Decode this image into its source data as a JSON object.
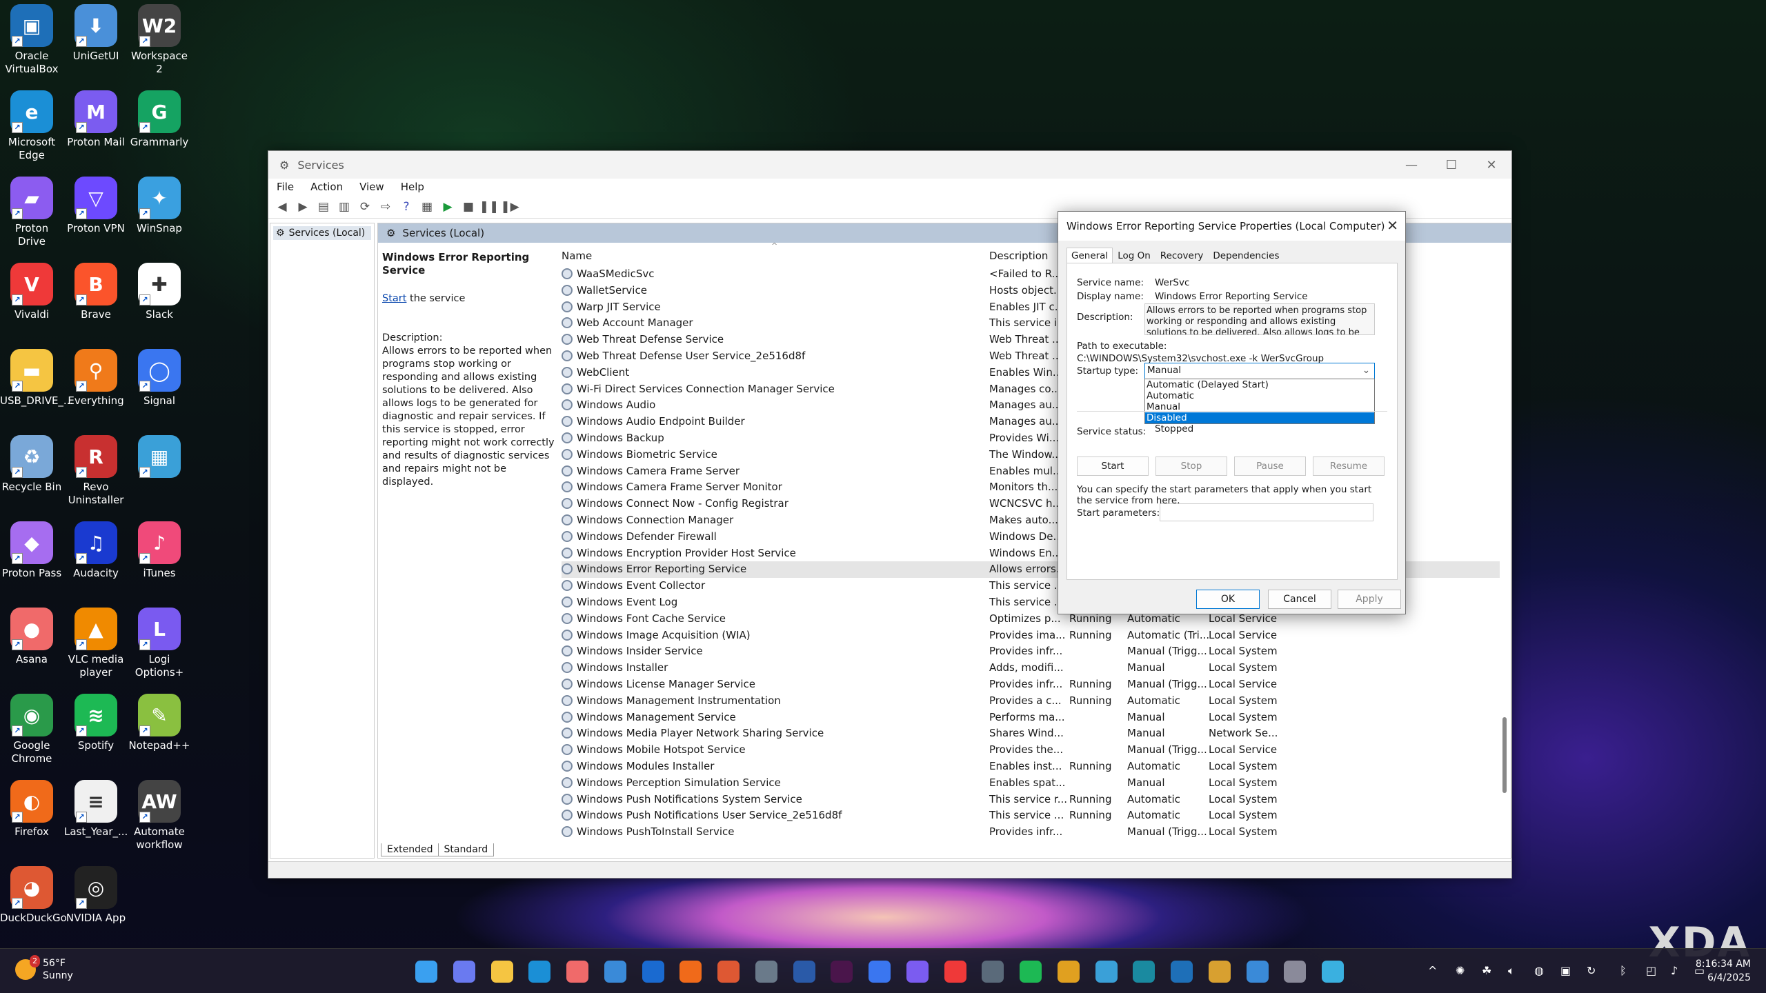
{
  "desktop_icons": [
    {
      "label": "Oracle VirtualBox",
      "icon": "virtualbox-icon",
      "color": "#1e6fb8",
      "glyph": "▣"
    },
    {
      "label": "UniGetUI",
      "icon": "unigetui-icon",
      "color": "#4a90d9",
      "glyph": "⬇"
    },
    {
      "label": "Workspace 2",
      "icon": "workspace-icon",
      "color": "#444444",
      "glyph": "W2"
    },
    {
      "label": "Microsoft Edge",
      "icon": "edge-icon",
      "color": "#1b8fd6",
      "glyph": "e"
    },
    {
      "label": "Proton Mail",
      "icon": "protonmail-icon",
      "color": "#7b5cf0",
      "glyph": "M"
    },
    {
      "label": "Grammarly",
      "icon": "grammarly-icon",
      "color": "#15a362",
      "glyph": "G"
    },
    {
      "label": "Proton Drive",
      "icon": "protondrive-icon",
      "color": "#8c5cf0",
      "glyph": "▰"
    },
    {
      "label": "Proton VPN",
      "icon": "protonvpn-icon",
      "color": "#6d4aff",
      "glyph": "▽"
    },
    {
      "label": "WinSnap",
      "icon": "winsnap-icon",
      "color": "#3aa0e0",
      "glyph": "✦"
    },
    {
      "label": "Vivaldi",
      "icon": "vivaldi-icon",
      "color": "#ef3939",
      "glyph": "V"
    },
    {
      "label": "Brave",
      "icon": "brave-icon",
      "color": "#fb542b",
      "glyph": "B"
    },
    {
      "label": "Slack",
      "icon": "slack-icon",
      "color": "#ffffff",
      "glyph": "✚"
    },
    {
      "label": "USB_DRIVE_...",
      "icon": "folder-icon",
      "color": "#f5c542",
      "glyph": "▬"
    },
    {
      "label": "Everything",
      "icon": "everything-icon",
      "color": "#f07a1a",
      "glyph": "⚲"
    },
    {
      "label": "Signal",
      "icon": "signal-icon",
      "color": "#3a76f0",
      "glyph": "◯"
    },
    {
      "label": "Recycle Bin",
      "icon": "recycle-bin-icon",
      "color": "#7aa8d8",
      "glyph": "♻"
    },
    {
      "label": "Revo Uninstaller",
      "icon": "revo-icon",
      "color": "#c83030",
      "glyph": "R"
    },
    {
      "label": "",
      "icon": "control-panel-icon",
      "color": "#3aa0d8",
      "glyph": "▦"
    },
    {
      "label": "Proton Pass",
      "icon": "protonpass-icon",
      "color": "#a66df0",
      "glyph": "◆"
    },
    {
      "label": "Audacity",
      "icon": "audacity-icon",
      "color": "#1a3ad0",
      "glyph": "♫"
    },
    {
      "label": "iTunes",
      "icon": "itunes-icon",
      "color": "#f04a7a",
      "glyph": "♪"
    },
    {
      "label": "Asana",
      "icon": "asana-icon",
      "color": "#f06a6a",
      "glyph": "●"
    },
    {
      "label": "VLC media player",
      "icon": "vlc-icon",
      "color": "#f08a00",
      "glyph": "▲"
    },
    {
      "label": "Logi Options+",
      "icon": "logi-icon",
      "color": "#7a5af0",
      "glyph": "L"
    },
    {
      "label": "Google Chrome",
      "icon": "chrome-icon",
      "color": "#2a9a4a",
      "glyph": "◉"
    },
    {
      "label": "Spotify",
      "icon": "spotify-icon",
      "color": "#1db954",
      "glyph": "≋"
    },
    {
      "label": "Notepad++",
      "icon": "notepadpp-icon",
      "color": "#8ac040",
      "glyph": "✎"
    },
    {
      "label": "Firefox",
      "icon": "firefox-icon",
      "color": "#f06a1a",
      "glyph": "◐"
    },
    {
      "label": "Last_Year_...",
      "icon": "document-icon",
      "color": "#f0f0f0",
      "glyph": "≡"
    },
    {
      "label": "Automate workflow",
      "icon": "automate-icon",
      "color": "#444444",
      "glyph": "AW"
    },
    {
      "label": "DuckDuckGo",
      "icon": "duckduckgo-icon",
      "color": "#de5833",
      "glyph": "◕"
    },
    {
      "label": "NVIDIA App",
      "icon": "nvidia-icon",
      "color": "#222222",
      "glyph": "◎"
    }
  ],
  "window": {
    "title": "Services",
    "menu": [
      "File",
      "Action",
      "View",
      "Help"
    ],
    "tree_node": "Services (Local)",
    "panel_header": "Services (Local)",
    "selected_service": "Windows Error Reporting Service",
    "start_link": "Start",
    "start_suffix": " the service",
    "description_label": "Description:",
    "description_text": "Allows errors to be reported when programs stop working or responding and allows existing solutions to be delivered. Also allows logs to be generated for diagnostic and repair services. If this service is stopped, error reporting might not work correctly and results of diagnostic services and repairs might not be displayed.",
    "columns": {
      "name": "Name",
      "description": "Description"
    },
    "bottom_tabs": [
      "Extended",
      "Standard"
    ]
  },
  "services": [
    {
      "name": "WaaSMedicSvc",
      "desc": "<Failed to R...",
      "status": "",
      "startup": "",
      "logon": ""
    },
    {
      "name": "WalletService",
      "desc": "Hosts object...",
      "status": "",
      "startup": "",
      "logon": ""
    },
    {
      "name": "Warp JIT Service",
      "desc": "Enables JIT c...",
      "status": "",
      "startup": "",
      "logon": ""
    },
    {
      "name": "Web Account Manager",
      "desc": "This service i...",
      "status": "",
      "startup": "",
      "logon": ""
    },
    {
      "name": "Web Threat Defense Service",
      "desc": "Web Threat ...",
      "status": "",
      "startup": "",
      "logon": ""
    },
    {
      "name": "Web Threat Defense User Service_2e516d8f",
      "desc": "Web Threat ...",
      "status": "",
      "startup": "",
      "logon": ""
    },
    {
      "name": "WebClient",
      "desc": "Enables Win...",
      "status": "",
      "startup": "",
      "logon": ""
    },
    {
      "name": "Wi-Fi Direct Services Connection Manager Service",
      "desc": "Manages co...",
      "status": "",
      "startup": "",
      "logon": ""
    },
    {
      "name": "Windows Audio",
      "desc": "Manages au...",
      "status": "",
      "startup": "",
      "logon": ""
    },
    {
      "name": "Windows Audio Endpoint Builder",
      "desc": "Manages au...",
      "status": "",
      "startup": "",
      "logon": ""
    },
    {
      "name": "Windows Backup",
      "desc": "Provides Wi...",
      "status": "",
      "startup": "",
      "logon": ""
    },
    {
      "name": "Windows Biometric Service",
      "desc": "The Window...",
      "status": "",
      "startup": "",
      "logon": ""
    },
    {
      "name": "Windows Camera Frame Server",
      "desc": "Enables mul...",
      "status": "",
      "startup": "",
      "logon": ""
    },
    {
      "name": "Windows Camera Frame Server Monitor",
      "desc": "Monitors th...",
      "status": "",
      "startup": "",
      "logon": ""
    },
    {
      "name": "Windows Connect Now - Config Registrar",
      "desc": "WCNCSVC h...",
      "status": "",
      "startup": "",
      "logon": ""
    },
    {
      "name": "Windows Connection Manager",
      "desc": "Makes auto...",
      "status": "",
      "startup": "",
      "logon": ""
    },
    {
      "name": "Windows Defender Firewall",
      "desc": "Windows De...",
      "status": "",
      "startup": "",
      "logon": ""
    },
    {
      "name": "Windows Encryption Provider Host Service",
      "desc": "Windows En...",
      "status": "",
      "startup": "",
      "logon": ""
    },
    {
      "name": "Windows Error Reporting Service",
      "desc": "Allows errors...",
      "status": "",
      "startup": "",
      "logon": "",
      "selected": true
    },
    {
      "name": "Windows Event Collector",
      "desc": "This service ...",
      "status": "",
      "startup": "",
      "logon": ""
    },
    {
      "name": "Windows Event Log",
      "desc": "This service ...",
      "status": "",
      "startup": "",
      "logon": ""
    },
    {
      "name": "Windows Font Cache Service",
      "desc": "Optimizes p...",
      "status": "Running",
      "startup": "Automatic",
      "logon": "Local Service"
    },
    {
      "name": "Windows Image Acquisition (WIA)",
      "desc": "Provides ima...",
      "status": "Running",
      "startup": "Automatic (Tri...",
      "logon": "Local Service"
    },
    {
      "name": "Windows Insider Service",
      "desc": "Provides infr...",
      "status": "",
      "startup": "Manual (Trigg...",
      "logon": "Local System"
    },
    {
      "name": "Windows Installer",
      "desc": "Adds, modifi...",
      "status": "",
      "startup": "Manual",
      "logon": "Local System"
    },
    {
      "name": "Windows License Manager Service",
      "desc": "Provides infr...",
      "status": "Running",
      "startup": "Manual (Trigg...",
      "logon": "Local Service"
    },
    {
      "name": "Windows Management Instrumentation",
      "desc": "Provides a c...",
      "status": "Running",
      "startup": "Automatic",
      "logon": "Local System"
    },
    {
      "name": "Windows Management Service",
      "desc": "Performs ma...",
      "status": "",
      "startup": "Manual",
      "logon": "Local System"
    },
    {
      "name": "Windows Media Player Network Sharing Service",
      "desc": "Shares Wind...",
      "status": "",
      "startup": "Manual",
      "logon": "Network Se..."
    },
    {
      "name": "Windows Mobile Hotspot Service",
      "desc": "Provides the...",
      "status": "",
      "startup": "Manual (Trigg...",
      "logon": "Local Service"
    },
    {
      "name": "Windows Modules Installer",
      "desc": "Enables inst...",
      "status": "Running",
      "startup": "Automatic",
      "logon": "Local System"
    },
    {
      "name": "Windows Perception Simulation Service",
      "desc": "Enables spat...",
      "status": "",
      "startup": "Manual",
      "logon": "Local System"
    },
    {
      "name": "Windows Push Notifications System Service",
      "desc": "This service r...",
      "status": "Running",
      "startup": "Automatic",
      "logon": "Local System"
    },
    {
      "name": "Windows Push Notifications User Service_2e516d8f",
      "desc": "This service ...",
      "status": "Running",
      "startup": "Automatic",
      "logon": "Local System"
    },
    {
      "name": "Windows PushToInstall Service",
      "desc": "Provides infr...",
      "status": "",
      "startup": "Manual (Trigg...",
      "logon": "Local System"
    }
  ],
  "dialog": {
    "title": "Windows Error Reporting Service Properties (Local Computer)",
    "tabs": [
      "General",
      "Log On",
      "Recovery",
      "Dependencies"
    ],
    "service_name_label": "Service name:",
    "service_name": "WerSvc",
    "display_name_label": "Display name:",
    "display_name": "Windows Error Reporting Service",
    "description_label": "Description:",
    "description": "Allows errors to be reported when programs stop working or responding and allows existing solutions to be delivered. Also allows logs to be generated for",
    "path_label": "Path to executable:",
    "path": "C:\\WINDOWS\\System32\\svchost.exe -k WerSvcGroup",
    "startup_type_label": "Startup type:",
    "startup_type": "Manual",
    "startup_options": [
      "Automatic (Delayed Start)",
      "Automatic",
      "Manual",
      "Disabled"
    ],
    "highlighted_option": "Disabled",
    "service_status_label": "Service status:",
    "service_status": "Stopped",
    "buttons": {
      "start": "Start",
      "stop": "Stop",
      "pause": "Pause",
      "resume": "Resume"
    },
    "hint": "You can specify the start parameters that apply when you start the service from here.",
    "start_params_label": "Start parameters:",
    "start_params": "",
    "ok": "OK",
    "cancel": "Cancel",
    "apply": "Apply"
  },
  "taskbar": {
    "weather_temp": "56°F",
    "weather_desc": "Sunny",
    "weather_badge": "2",
    "time": "8:16:34 AM",
    "date": "6/4/2025",
    "apps": [
      {
        "icon": "start-icon",
        "color": "#3aa0f0"
      },
      {
        "icon": "copilot-icon",
        "color": "#6a7af0"
      },
      {
        "icon": "file-explorer-icon",
        "color": "#f5c542"
      },
      {
        "icon": "edge-icon",
        "color": "#1b8fd6"
      },
      {
        "icon": "asana-icon",
        "color": "#f06a6a"
      },
      {
        "icon": "store-icon",
        "color": "#3a8ad8"
      },
      {
        "icon": "outlook-icon",
        "color": "#1a6ad0"
      },
      {
        "icon": "firefox-icon",
        "color": "#f06a1a"
      },
      {
        "icon": "duckduckgo-icon",
        "color": "#de5833"
      },
      {
        "icon": "settings-app-icon",
        "color": "#6a7a8a"
      },
      {
        "icon": "word-icon",
        "color": "#2a5aa8"
      },
      {
        "icon": "slack-icon",
        "color": "#4a154b"
      },
      {
        "icon": "signal-icon",
        "color": "#3a76f0"
      },
      {
        "icon": "protonmail-icon",
        "color": "#7b5cf0"
      },
      {
        "icon": "vivaldi-icon",
        "color": "#ef3939"
      },
      {
        "icon": "calculator-icon",
        "color": "#5a6a7a"
      },
      {
        "icon": "spotify-icon",
        "color": "#1db954"
      },
      {
        "icon": "paint-icon",
        "color": "#e0a020"
      },
      {
        "icon": "notepad-icon",
        "color": "#3aa0d8"
      },
      {
        "icon": "sway-icon",
        "color": "#1a8aa0"
      },
      {
        "icon": "virtualbox-icon",
        "color": "#1e6fb8"
      },
      {
        "icon": "winsnap-icon",
        "color": "#d8a030"
      },
      {
        "icon": "photos-icon",
        "color": "#3a8ad8"
      },
      {
        "icon": "gear-icon",
        "color": "#8a8a9a"
      },
      {
        "icon": "snip-icon",
        "color": "#3ab0e0"
      }
    ]
  },
  "watermark": "XDA"
}
